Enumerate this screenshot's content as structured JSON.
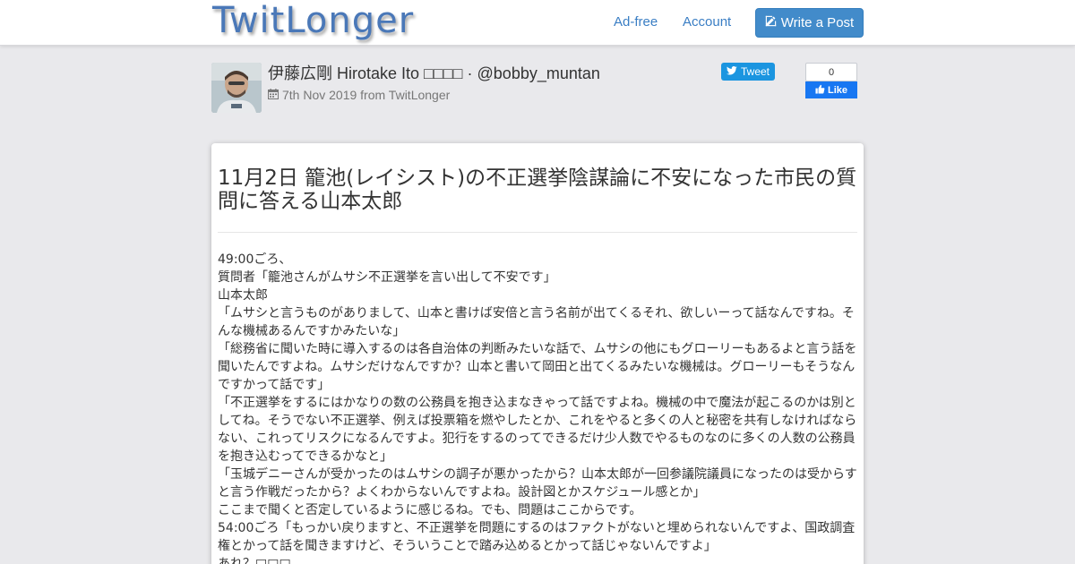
{
  "navbar": {
    "logo": "TwitLonger",
    "links": [
      "Ad-free",
      "Account"
    ],
    "write_button": "Write a Post",
    "accent_color": "#428bca"
  },
  "post_header": {
    "author": "伊藤広剛 Hirotake Ito □□□□ · @bobby_muntan",
    "date_line": "7th Nov 2019 from TwitLonger",
    "tweet_button": "Tweet",
    "fb_count": "0",
    "fb_like": "Like"
  },
  "post": {
    "title": "11月2日 籠池(レイシスト)の不正選挙陰謀論に不安になった市民の質問に答える山本太郎",
    "lines": [
      "49:00ごろ、",
      "質問者「籠池さんがムサシ不正選挙を言い出して不安です」",
      "山本太郎",
      "「ムサシと言うものがありまして、山本と書けば安倍と言う名前が出てくるそれ、欲しいーって話なんですね。そんな機械あるんですかみたいな」",
      "「総務省に聞いた時に導入するのは各自治体の判断みたいな話で、ムサシの他にもグローリーもあるよと言う話を聞いたんですよね。ムサシだけなんですか？山本と書いて岡田と出てくるみたいな機械は。グローリーもそうなんですかって話です」",
      "「不正選挙をするにはかなりの数の公務員を抱き込まなきゃって話ですよね。機械の中で魔法が起こるのかは別としてね。そうでない不正選挙、例えば投票箱を燃やしたとか、これをやると多くの人と秘密を共有しなければならない、これってリスクになるんですよ。犯行をするのってできるだけ少人数でやるものなのに多くの人数の公務員を抱き込むってできるかなと」",
      "「玉城デニーさんが受かったのはムサシの調子が悪かったから？山本太郎が一回参議院議員になったのは受からすと言う作戦だったから？よくわからないんですよね。設計図とかスケジュール感とか」",
      "ここまで聞くと否定しているように感じるね。でも、問題はここからです。",
      "54:00ごろ「もっかい戻りますと、不正選挙を問題にするのはファクトがないと埋められないんですよ、国政調査権とかって話を聞きますけど、そういうことで踏み込めるとかって話じゃないんですよ」",
      "あれ？□□□"
    ]
  }
}
